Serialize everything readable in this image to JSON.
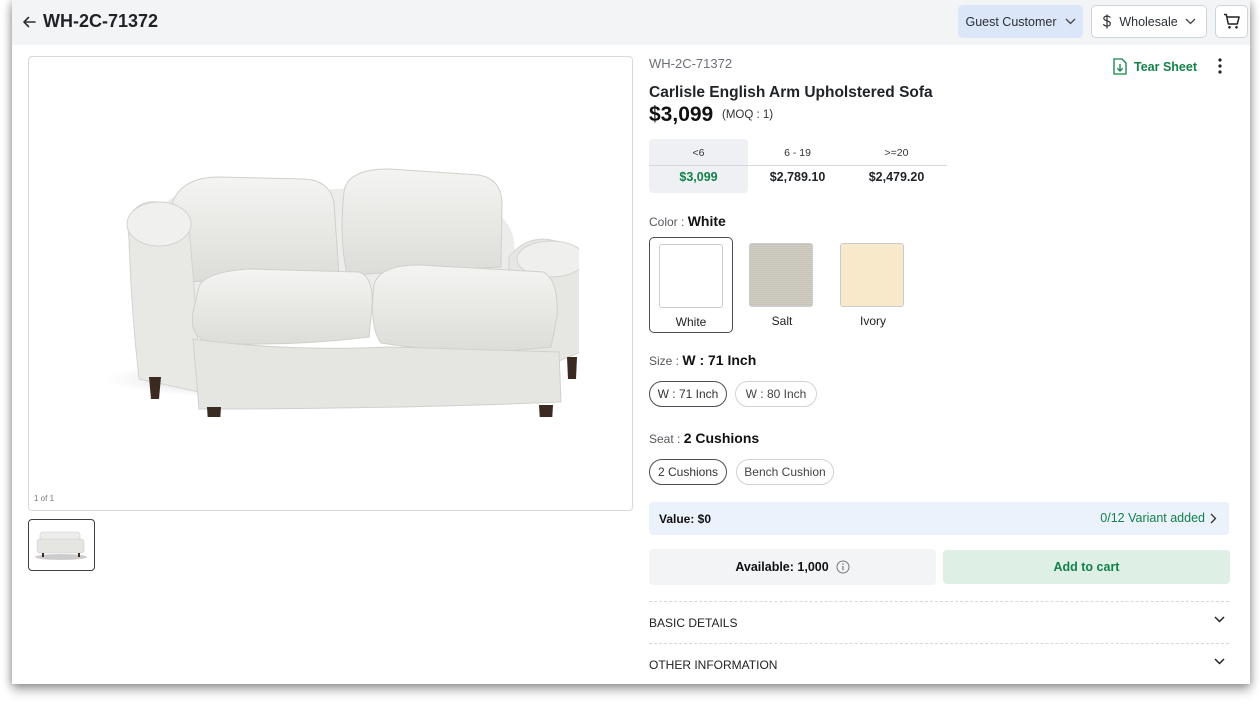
{
  "header": {
    "title": "WH-2C-71372",
    "customer_select": "Guest Customer",
    "pricing_select": "Wholesale"
  },
  "gallery": {
    "counter": "1 of 1",
    "thumbnails": 1
  },
  "product": {
    "sku": "WH-2C-71372",
    "name": "Carlisle English Arm Upholstered Sofa",
    "price": "$3,099",
    "moq": "(MOQ : 1)",
    "tear_sheet": "Tear Sheet",
    "price_tiers": [
      {
        "qty": "<6",
        "price": "$3,099"
      },
      {
        "qty": "6 - 19",
        "price": "$2,789.10"
      },
      {
        "qty": ">=20",
        "price": "$2,479.20"
      }
    ]
  },
  "options": {
    "color": {
      "label": "Color :",
      "selected": "White",
      "swatches": [
        {
          "name": "White",
          "color": "#ffffff"
        },
        {
          "name": "Salt",
          "color": "#e4e2dc"
        },
        {
          "name": "Ivory",
          "color": "#f8e9cb"
        }
      ]
    },
    "size": {
      "label": "Size :",
      "selected": "W : 71 Inch",
      "choices": [
        "W : 71 Inch",
        "W : 80 Inch"
      ]
    },
    "seat": {
      "label": "Seat :",
      "selected": "2 Cushions",
      "choices": [
        "2 Cushions",
        "Bench Cushion"
      ]
    }
  },
  "summary": {
    "value": "Value: $0",
    "variants_added": "0/12 Variant added",
    "available": "Available: 1,000",
    "add_to_cart": "Add to cart"
  },
  "accordions": [
    "BASIC DETAILS",
    "OTHER INFORMATION"
  ],
  "colors": {
    "accent_green": "#14804a",
    "guest_bg": "#dbe7f8",
    "value_bar_bg": "#ebf2fc",
    "add_cart_bg": "#def0e6"
  }
}
